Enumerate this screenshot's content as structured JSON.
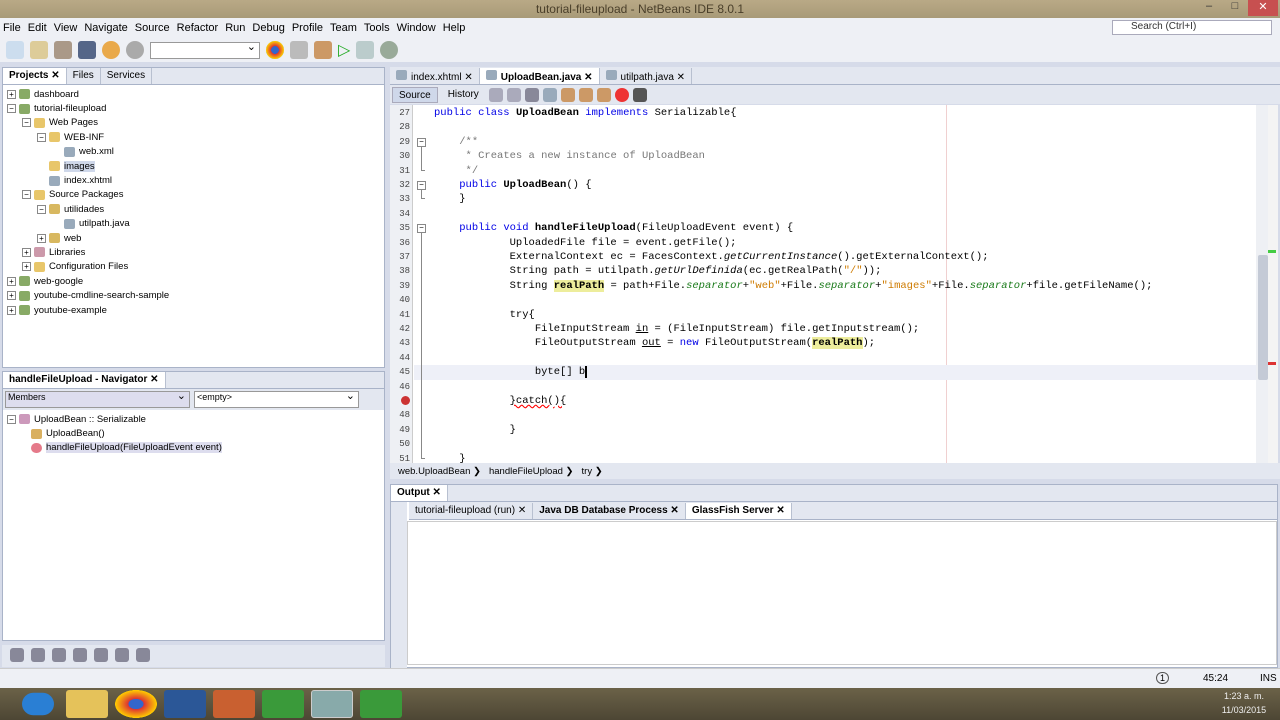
{
  "window": {
    "title": "tutorial-fileupload - NetBeans IDE 8.0.1"
  },
  "menu": [
    "File",
    "Edit",
    "View",
    "Navigate",
    "Source",
    "Refactor",
    "Run",
    "Debug",
    "Profile",
    "Team",
    "Tools",
    "Window",
    "Help"
  ],
  "search": {
    "placeholder": "Search (Ctrl+I)"
  },
  "projects": {
    "tabs": [
      "Projects",
      "Files",
      "Services"
    ],
    "tree": [
      {
        "label": "dashboard",
        "level": 0,
        "exp": "+",
        "color": "#8a6"
      },
      {
        "label": "tutorial-fileupload",
        "level": 0,
        "exp": "-",
        "color": "#8a6"
      },
      {
        "label": "Web Pages",
        "level": 1,
        "exp": "-",
        "color": "#e8c66a"
      },
      {
        "label": "WEB-INF",
        "level": 2,
        "exp": "-",
        "color": "#e8c66a"
      },
      {
        "label": "web.xml",
        "level": 3,
        "exp": "",
        "color": "#9ab"
      },
      {
        "label": "images",
        "level": 2,
        "exp": "",
        "color": "#e8c66a",
        "selected": true
      },
      {
        "label": "index.xhtml",
        "level": 2,
        "exp": "",
        "color": "#9ab"
      },
      {
        "label": "Source Packages",
        "level": 1,
        "exp": "-",
        "color": "#e8c66a"
      },
      {
        "label": "utilidades",
        "level": 2,
        "exp": "-",
        "color": "#d8b860"
      },
      {
        "label": "utilpath.java",
        "level": 3,
        "exp": "",
        "color": "#9ab"
      },
      {
        "label": "web",
        "level": 2,
        "exp": "+",
        "color": "#d8b860"
      },
      {
        "label": "Libraries",
        "level": 1,
        "exp": "+",
        "color": "#c9a"
      },
      {
        "label": "Configuration Files",
        "level": 1,
        "exp": "+",
        "color": "#e8c66a"
      },
      {
        "label": "web-google",
        "level": 0,
        "exp": "+",
        "color": "#8a6"
      },
      {
        "label": "youtube-cmdline-search-sample",
        "level": 0,
        "exp": "+",
        "color": "#8a6"
      },
      {
        "label": "youtube-example",
        "level": 0,
        "exp": "+",
        "color": "#8a6"
      }
    ]
  },
  "navigator": {
    "title": "handleFileUpload - Navigator",
    "filter": "Members",
    "combo2": "<empty>",
    "items": [
      {
        "label": "UploadBean :: Serializable",
        "level": 0
      },
      {
        "label": "UploadBean()",
        "level": 1
      },
      {
        "label": "handleFileUpload(FileUploadEvent event)",
        "level": 1
      }
    ]
  },
  "editor": {
    "tabs": [
      "index.xhtml",
      "UploadBean.java",
      "utilpath.java"
    ],
    "active": 1,
    "source": "Source",
    "history": "History",
    "lines": [
      {
        "n": "27",
        "html": "<span class='kw'>public class</span> <span class='b'>UploadBean</span> <span class='kw'>implements</span> Serializable{"
      },
      {
        "n": "28",
        "html": ""
      },
      {
        "n": "29",
        "html": "    <span class='cm'>/**</span>"
      },
      {
        "n": "30",
        "html": "    <span class='cm'> * Creates a new instance of UploadBean</span>"
      },
      {
        "n": "31",
        "html": "    <span class='cm'> */</span>"
      },
      {
        "n": "32",
        "html": "    <span class='kw'>public</span> <span class='b'>UploadBean</span>() {"
      },
      {
        "n": "33",
        "html": "    }"
      },
      {
        "n": "34",
        "html": ""
      },
      {
        "n": "35",
        "html": "    <span class='kw'>public void</span> <span class='b'>handleFileUpload</span>(FileUploadEvent event) {"
      },
      {
        "n": "36",
        "html": "            UploadedFile file = event.getFile();"
      },
      {
        "n": "37",
        "html": "            ExternalContext ec = FacesContext.<i>getCurrentInstance</i>().getExternalContext();"
      },
      {
        "n": "38",
        "html": "            String path = utilpath.<i>getUrlDefinida</i>(ec.getRealPath(<span class='st'>\"/\"</span>));"
      },
      {
        "n": "39",
        "html": "            String <span class='hl'>realPath</span> = path+File.<span class='it'>separator</span>+<span class='st'>\"web\"</span>+File.<span class='it'>separator</span>+<span class='st'>\"images\"</span>+File.<span class='it'>separator</span>+file.getFileName();"
      },
      {
        "n": "40",
        "html": ""
      },
      {
        "n": "41",
        "html": "            try{"
      },
      {
        "n": "42",
        "html": "                FileInputStream <u>in</u> = (FileInputStream) file.getInputstream();"
      },
      {
        "n": "43",
        "html": "                FileOutputStream <u>out</u> = <span class='kw'>new</span> FileOutputStream(<span class='hl'>realPath</span>);"
      },
      {
        "n": "44",
        "html": ""
      },
      {
        "n": "45",
        "html": "                byte[] b<span style='border-left:2px solid #000'></span>"
      },
      {
        "n": "46",
        "html": ""
      },
      {
        "n": "",
        "html": "            <span style='text-decoration:underline wavy red'>}catch(){</span>"
      },
      {
        "n": "48",
        "html": ""
      },
      {
        "n": "49",
        "html": "            }"
      },
      {
        "n": "50",
        "html": ""
      },
      {
        "n": "51",
        "html": "    }"
      }
    ]
  },
  "breadcrumb": [
    "web.UploadBean",
    "handleFileUpload",
    "try"
  ],
  "output": {
    "title": "Output",
    "tabs": [
      "tutorial-fileupload (run)",
      "Java DB Database Process",
      "GlassFish Server"
    ],
    "active": 2
  },
  "status": {
    "notifications": "1",
    "position": "45:24",
    "mode": "INS"
  },
  "tray": {
    "time": "1:23 a. m.",
    "date": "11/03/2015"
  }
}
